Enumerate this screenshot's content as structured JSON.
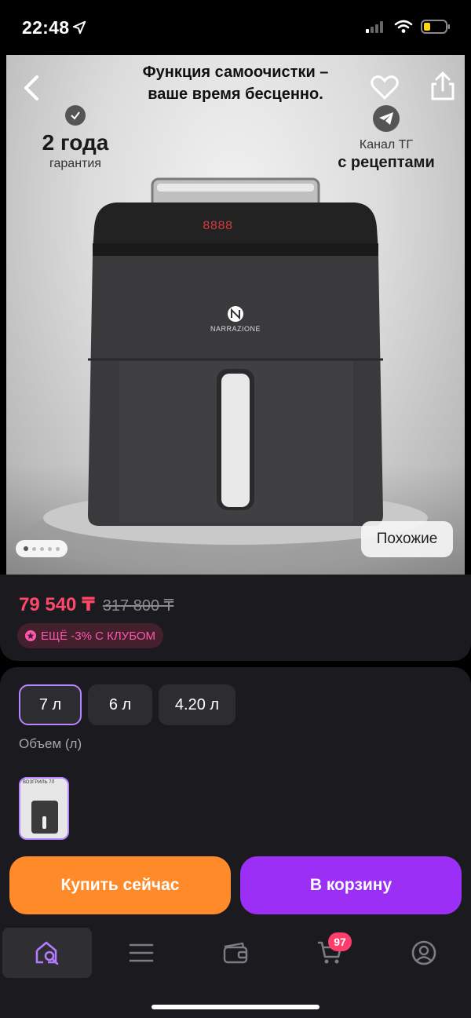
{
  "status_bar": {
    "time": "22:48"
  },
  "hero": {
    "headline_line1": "Функция самоочистки –",
    "headline_line2": "ваше время бесценно.",
    "warranty_big": "2 года",
    "warranty_small": "гарантия",
    "channel_line1": "Канал ТГ",
    "channel_line2": "с рецептами",
    "brand": "NARRAZIONE",
    "display_digits": "8888",
    "similar_label": "Похожие",
    "gallery_pages": 5,
    "gallery_current": 1
  },
  "price": {
    "current": "79 540 ₸",
    "old": "317 800 ₸",
    "club_badge": "ЕЩЁ -3% С КЛУБОМ"
  },
  "options": {
    "volumes": [
      "7 л",
      "6 л",
      "4.20 л"
    ],
    "selected_volume": "7 л",
    "volume_label": "Объем (л)",
    "thumb_caption": "ВОЗГРИЛЬ 7Л"
  },
  "actions": {
    "buy_now": "Купить сейчас",
    "to_cart": "В корзину"
  },
  "tabbar": {
    "items": [
      "search-home",
      "catalog",
      "wallet",
      "cart",
      "profile"
    ],
    "active": "search-home",
    "cart_count": "97"
  },
  "colors": {
    "price": "#ff4769",
    "accent_purple": "#9b2ff5",
    "accent_orange": "#ff8a2a",
    "club": "#ff57b0",
    "cart_badge": "#ff3d6e"
  }
}
